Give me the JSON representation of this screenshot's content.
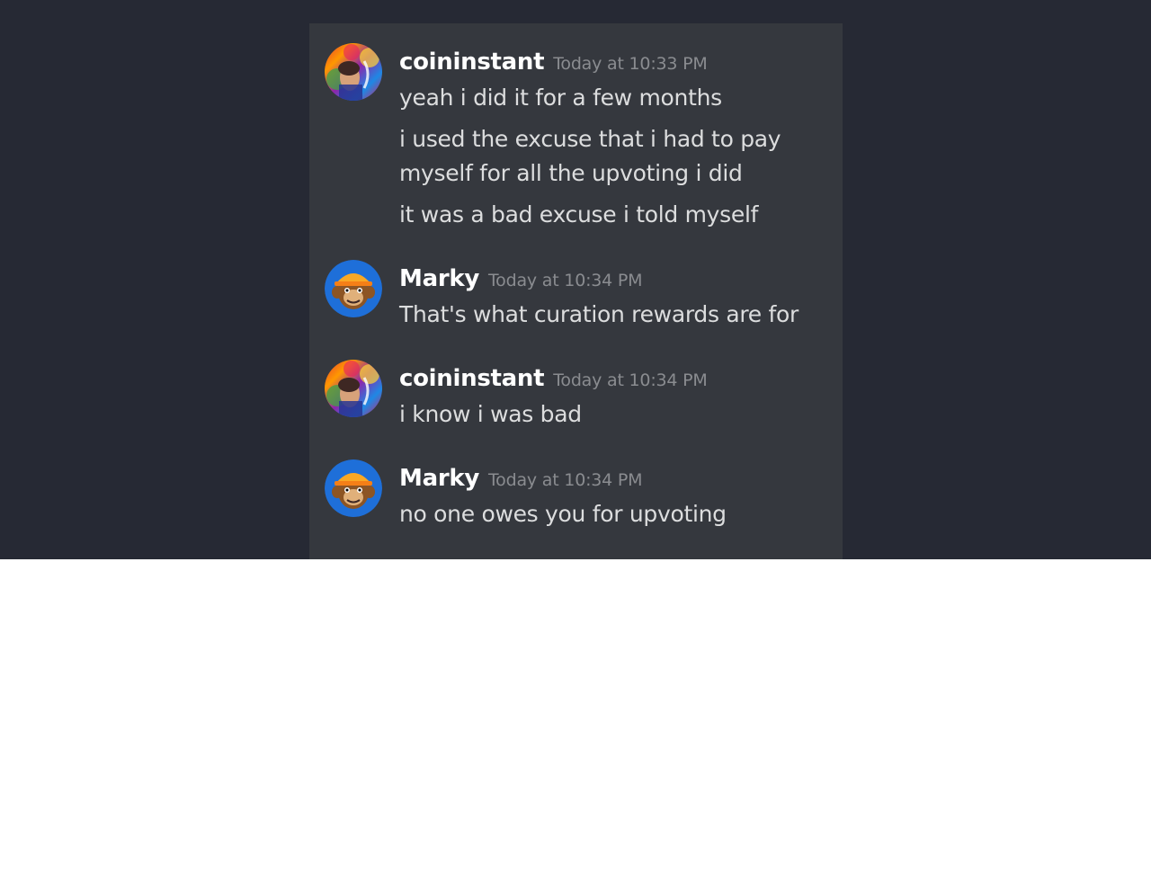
{
  "messages": [
    {
      "author": "coininstant",
      "timestamp": "Today at 10:33 PM",
      "avatar_icon": "rainbow-portrait-avatar",
      "lines": [
        "yeah i did it for a few months",
        "i used the excuse that i had to pay myself for all the upvoting i did",
        "it was a bad excuse i told myself"
      ]
    },
    {
      "author": "Marky",
      "timestamp": "Today at 10:34 PM",
      "avatar_icon": "monkey-hardhat-avatar",
      "lines": [
        "That's what curation rewards are for"
      ]
    },
    {
      "author": "coininstant",
      "timestamp": "Today at 10:34 PM",
      "avatar_icon": "rainbow-portrait-avatar",
      "lines": [
        "i know i was bad"
      ]
    },
    {
      "author": "Marky",
      "timestamp": "Today at 10:34 PM",
      "avatar_icon": "monkey-hardhat-avatar",
      "lines": [
        "no one owes you for upvoting"
      ]
    }
  ],
  "colors": {
    "page_background": "#262934",
    "panel_background": "#35383e",
    "username": "#ffffff",
    "timestamp": "#8a8c90",
    "message_text": "#dcddde",
    "marky_avatar_ring": "#1e6fd9"
  }
}
